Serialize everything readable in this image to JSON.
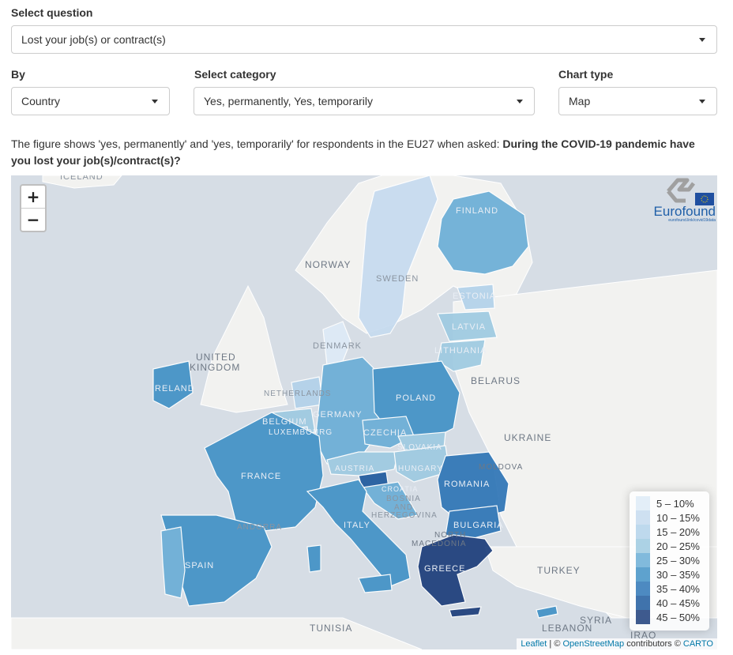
{
  "question": {
    "label": "Select question",
    "value": "Lost your job(s) or contract(s)"
  },
  "by": {
    "label": "By",
    "value": "Country"
  },
  "category": {
    "label": "Select category",
    "value": "Yes, permanently, Yes, temporarily"
  },
  "chart_type": {
    "label": "Chart type",
    "value": "Map"
  },
  "description": {
    "text": "The figure shows 'yes, permanently' and 'yes, temporarily' for respondents in the EU27 when asked: ",
    "question_bold": "During the COVID-19 pandemic have you lost your job(s)/contract(s)?"
  },
  "map": {
    "zoom_in": "+",
    "zoom_out": "−",
    "logo_text": "Eurofound",
    "logo_sub": "eurofound.link/covid19data",
    "attribution": {
      "leaflet": "Leaflet",
      "mid": " | © ",
      "osm": "OpenStreetMap",
      "contrib": " contributors © ",
      "carto": "CARTO"
    },
    "labels": {
      "iceland": "ICELAND",
      "norway": "NORWAY",
      "sweden": "SWEDEN",
      "finland": "FINLAND",
      "estonia": "ESTONIA",
      "latvia": "LATVIA",
      "lithuania": "LITHUANIA",
      "denmark": "DENMARK",
      "uk": "UNITED",
      "uk2": "KINGDOM",
      "ireland": "IRELAND",
      "netherlands": "NETHERLANDS",
      "belgium": "BELGIUM",
      "luxembourg": "LUXEMBOURG",
      "germany": "GERMANY",
      "poland": "POLAND",
      "belarus": "BELARUS",
      "czechia": "CZECHIA",
      "slovakia": "SLOVAKIA",
      "ukraine": "UKRAINE",
      "moldova": "MOLDOVA",
      "austria": "AUSTRIA",
      "hungary": "HUNGARY",
      "romania": "ROMANIA",
      "france": "FRANCE",
      "croatia": "CROATIA",
      "bosnia": "BOSNIA",
      "bosnia2": "AND",
      "bosnia3": "HERZEGOVINA",
      "bulgaria": "BULGARIA",
      "andorra": "ANDORRA",
      "italy": "ITALY",
      "north_mac": "NORTH",
      "north_mac2": "MACEDONIA",
      "spain": "SPAIN",
      "greece": "GREECE",
      "turkey": "TURKEY",
      "tunisia": "TUNISIA",
      "syria": "SYRIA",
      "lebanon": "LEBANON",
      "iraq": "IRAQ"
    },
    "legend": [
      {
        "range": "5 – 10%",
        "color": "#deebf7"
      },
      {
        "range": "10 – 15%",
        "color": "#c6dbef"
      },
      {
        "range": "15 – 20%",
        "color": "#b3d2ea"
      },
      {
        "range": "20 – 25%",
        "color": "#9ecae1"
      },
      {
        "range": "25 – 30%",
        "color": "#6baed6"
      },
      {
        "range": "30 – 35%",
        "color": "#4292c6"
      },
      {
        "range": "35 – 40%",
        "color": "#2e75b6"
      },
      {
        "range": "40 – 45%",
        "color": "#1f5a9e"
      },
      {
        "range": "45 – 50%",
        "color": "#1c3d7a"
      }
    ]
  }
}
